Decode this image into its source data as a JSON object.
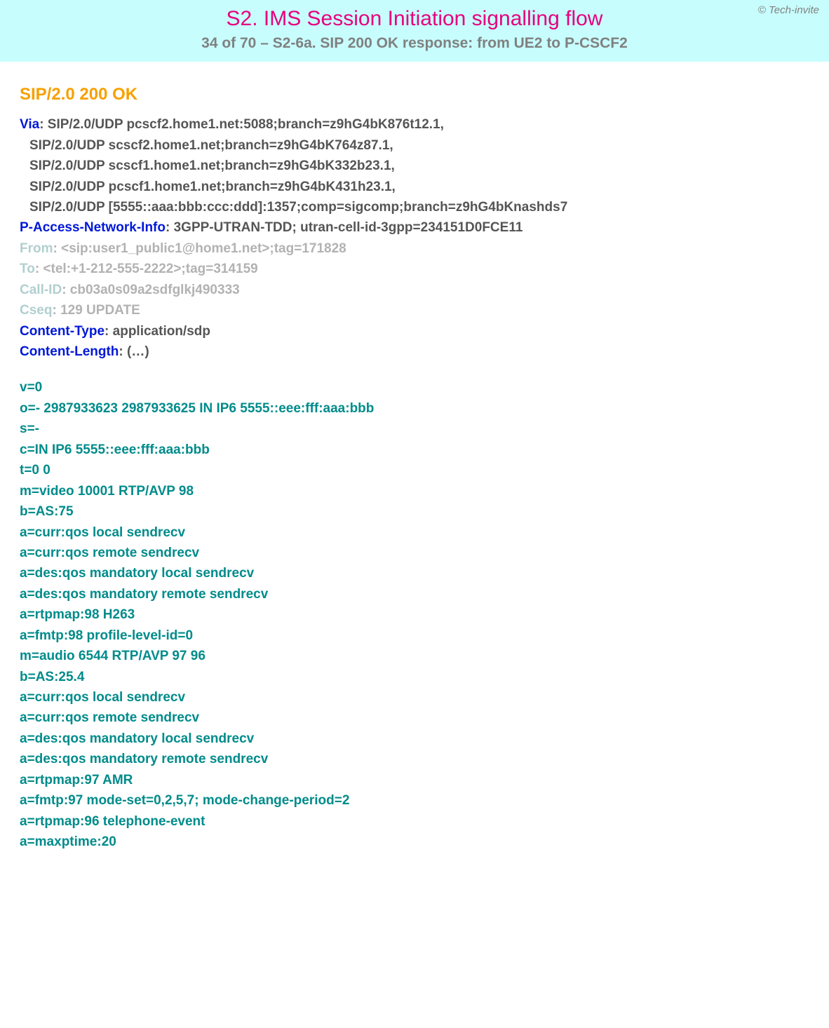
{
  "header": {
    "copyright": "© Tech-invite",
    "title": "S2. IMS Session Initiation signalling flow",
    "subtitle": "34 of 70 – S2-6a. SIP 200 OK response: from UE2 to P-CSCF2"
  },
  "sip": {
    "status_line": "SIP/2.0 200 OK",
    "via": {
      "name": "Via",
      "first": "SIP/2.0/UDP pcscf2.home1.net:5088;branch=z9hG4bK876t12.1,",
      "cont": [
        "SIP/2.0/UDP scscf2.home1.net;branch=z9hG4bK764z87.1,",
        "SIP/2.0/UDP scscf1.home1.net;branch=z9hG4bK332b23.1,",
        "SIP/2.0/UDP pcscf1.home1.net;branch=z9hG4bK431h23.1,",
        "SIP/2.0/UDP [5555::aaa:bbb:ccc:ddd]:1357;comp=sigcomp;branch=z9hG4bKnashds7"
      ]
    },
    "pani": {
      "name": "P-Access-Network-Info",
      "value": "3GPP-UTRAN-TDD; utran-cell-id-3gpp=234151D0FCE11"
    },
    "from": {
      "name": "From",
      "value": "<sip:user1_public1@home1.net>;tag=171828"
    },
    "to": {
      "name": "To",
      "value": "<tel:+1-212-555-2222>;tag=314159"
    },
    "callid": {
      "name": "Call-ID",
      "value": "cb03a0s09a2sdfglkj490333"
    },
    "cseq": {
      "name": "Cseq",
      "value": "129 UPDATE"
    },
    "ctype": {
      "name": "Content-Type",
      "value": "application/sdp"
    },
    "clen": {
      "name": "Content-Length",
      "value": "(…)"
    }
  },
  "sdp": [
    "v=0",
    "o=- 2987933623 2987933625 IN IP6 5555::eee:fff:aaa:bbb",
    "s=-",
    "c=IN IP6 5555::eee:fff:aaa:bbb",
    "t=0 0",
    "m=video 10001 RTP/AVP 98",
    "b=AS:75",
    "a=curr:qos local sendrecv",
    "a=curr:qos remote sendrecv",
    "a=des:qos mandatory local sendrecv",
    "a=des:qos mandatory remote sendrecv",
    "a=rtpmap:98 H263",
    "a=fmtp:98 profile-level-id=0",
    "m=audio 6544 RTP/AVP 97 96",
    "b=AS:25.4",
    "a=curr:qos local sendrecv",
    "a=curr:qos remote sendrecv",
    "a=des:qos mandatory local sendrecv",
    "a=des:qos mandatory remote sendrecv",
    "a=rtpmap:97 AMR",
    "a=fmtp:97 mode-set=0,2,5,7; mode-change-period=2",
    "a=rtpmap:96 telephone-event",
    "a=maxptime:20"
  ]
}
